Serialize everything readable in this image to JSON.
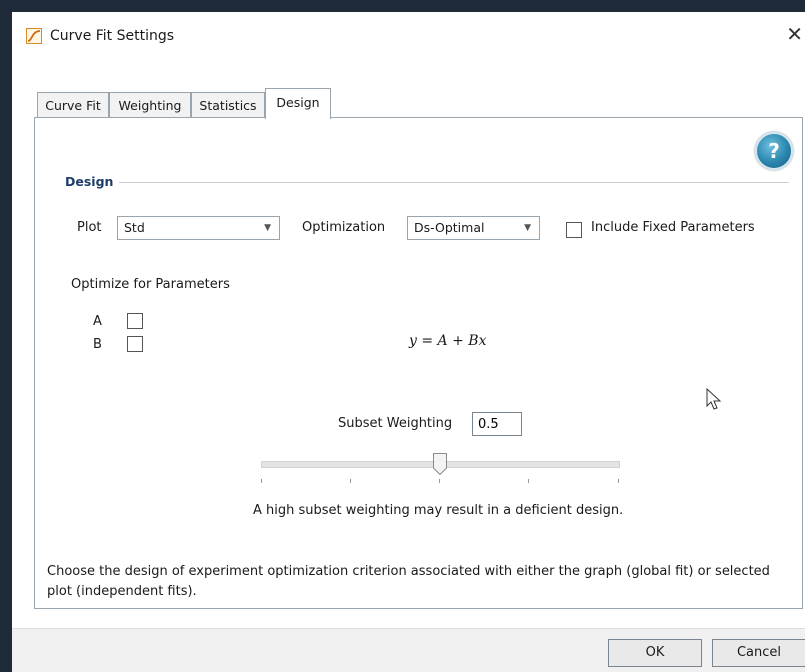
{
  "window": {
    "title": "Curve Fit Settings",
    "close_glyph": "✕"
  },
  "tabs": [
    {
      "label": "Curve Fit"
    },
    {
      "label": "Weighting"
    },
    {
      "label": "Statistics"
    },
    {
      "label": "Design",
      "active": true
    }
  ],
  "help": {
    "glyph": "?"
  },
  "design": {
    "section_label": "Design",
    "plot_label": "Plot",
    "plot_value": "Std",
    "optimization_label": "Optimization",
    "optimization_value": "Ds-Optimal",
    "include_fixed_label": "Include Fixed Parameters",
    "include_fixed_checked": false,
    "optimize_label": "Optimize for Parameters",
    "parameters": [
      {
        "name": "A",
        "checked": false
      },
      {
        "name": "B",
        "checked": false
      }
    ],
    "formula": "y = A + Bx",
    "subset_label": "Subset Weighting",
    "subset_value": "0.5",
    "slider_value": 0.5,
    "warning": "A high subset weighting may result in a deficient design.",
    "description_line1": "Choose the design of experiment optimization criterion associated with either the graph (global fit) or selected",
    "description_line2": "plot (independent fits)."
  },
  "buttons": {
    "ok": "OK",
    "cancel": "Cancel"
  },
  "icons": {
    "dropdown": "chevron-down-icon",
    "help": "help-icon",
    "app": "curve-fit-icon",
    "cursor": "mouse-cursor-icon"
  }
}
